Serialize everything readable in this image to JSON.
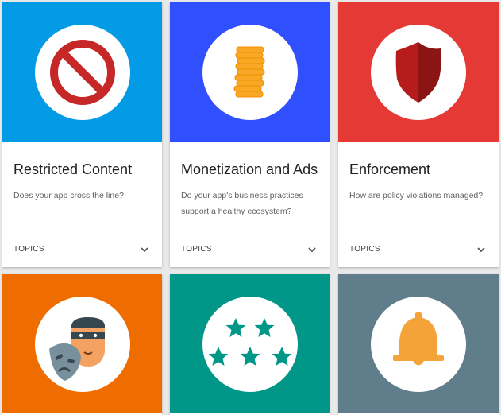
{
  "cards": [
    {
      "title": "Restricted Content",
      "description": "Does your app cross the line?",
      "topics_label": "TOPICS",
      "hero_color": "#039be5",
      "icon": "prohibited-sign-icon"
    },
    {
      "title": "Monetization and Ads",
      "description": "Do your app's business practices support a healthy ecosystem?",
      "topics_label": "TOPICS",
      "hero_color": "#304ffe",
      "icon": "coin-stack-icon"
    },
    {
      "title": "Enforcement",
      "description": "How are policy violations managed?",
      "topics_label": "TOPICS",
      "hero_color": "#e53935",
      "icon": "shield-icon"
    },
    {
      "hero_color": "#ef6c00",
      "icon": "masked-person-icon"
    },
    {
      "hero_color": "#009688",
      "icon": "stars-rating-icon"
    },
    {
      "hero_color": "#607d8b",
      "icon": "bell-icon"
    }
  ]
}
